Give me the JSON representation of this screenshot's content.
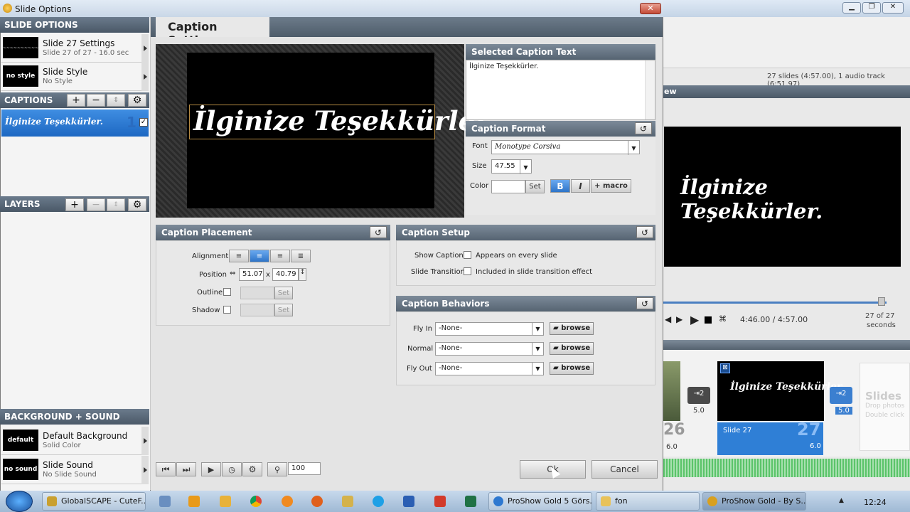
{
  "window": {
    "title": "Slide Options"
  },
  "sidebar": {
    "slide_options_header": "SLIDE OPTIONS",
    "slide_settings": {
      "title": "Slide 27 Settings",
      "sub": "Slide 27 of 27 - 16.0 sec"
    },
    "slide_style": {
      "thumb": "no style",
      "title": "Slide Style",
      "sub": "No Style"
    },
    "captions_header": "CAPTIONS",
    "caption_item": {
      "text": "İlginize Teşekkürler.",
      "number": "1"
    },
    "layers_header": "LAYERS",
    "bg_header": "BACKGROUND + SOUND",
    "background": {
      "thumb": "default",
      "title": "Default Background",
      "sub": "Solid Color"
    },
    "sound": {
      "thumb": "no sound",
      "title": "Slide Sound",
      "sub": "No Slide Sound"
    }
  },
  "tab": {
    "label": "Caption Settings"
  },
  "preview": {
    "caption": "İlginize Teşekkürler."
  },
  "selected_caption": {
    "header": "Selected Caption Text",
    "text": "İlginize Teşekkürler."
  },
  "caption_format": {
    "header": "Caption Format",
    "font_label": "Font",
    "font_value": "Monotype Corsiva",
    "size_label": "Size",
    "size_value": "47.55",
    "color_label": "Color",
    "set": "Set",
    "bold": "B",
    "italic": "I",
    "macro": "+ macro"
  },
  "placement": {
    "header": "Caption Placement",
    "alignment": "Alignment",
    "position": "Position",
    "pos_x": "51.07",
    "x_sep": "x",
    "pos_y": "40.79",
    "outline": "Outline",
    "shadow": "Shadow",
    "set": "Set"
  },
  "setup": {
    "header": "Caption Setup",
    "show_caption": "Show Caption",
    "appears": "Appears on every slide",
    "slide_transition": "Slide Transition",
    "included": "Included in slide transition effect"
  },
  "behaviors": {
    "header": "Caption Behaviors",
    "fly_in": "Fly In",
    "normal": "Normal",
    "fly_out": "Fly Out",
    "none": "-None-",
    "browse": "browse"
  },
  "bottom": {
    "zoom": "100",
    "ok": "Ok",
    "cancel": "Cancel"
  },
  "background_app": {
    "status": "27 slides (4:57.00), 1 audio track (6:51.97)",
    "preview_tab": "ew",
    "preview_caption": "İlginize Teşekkürler.",
    "time": "4:46.00 / 4:57.00",
    "slide_count": "27 of 27",
    "seconds": "seconds",
    "thumb_num1": "5.0",
    "thumb_num2": "5.0",
    "num26": "26",
    "dur26": "6.0",
    "slide27_caption": "İlginize Teşekkürler.",
    "slide27_label": "Slide 27",
    "slide27_num": "27",
    "slide27_dur": "6.0",
    "slides_placeholder": "Slides",
    "drop_hint": "Drop photos",
    "dbl_hint": "Double click"
  },
  "taskbar": {
    "items": [
      "GlobalSCAPE - CuteF...",
      "ProShow Gold 5 Görs...",
      "fon",
      "ProShow Gold - By S..."
    ],
    "clock": "12:24"
  }
}
